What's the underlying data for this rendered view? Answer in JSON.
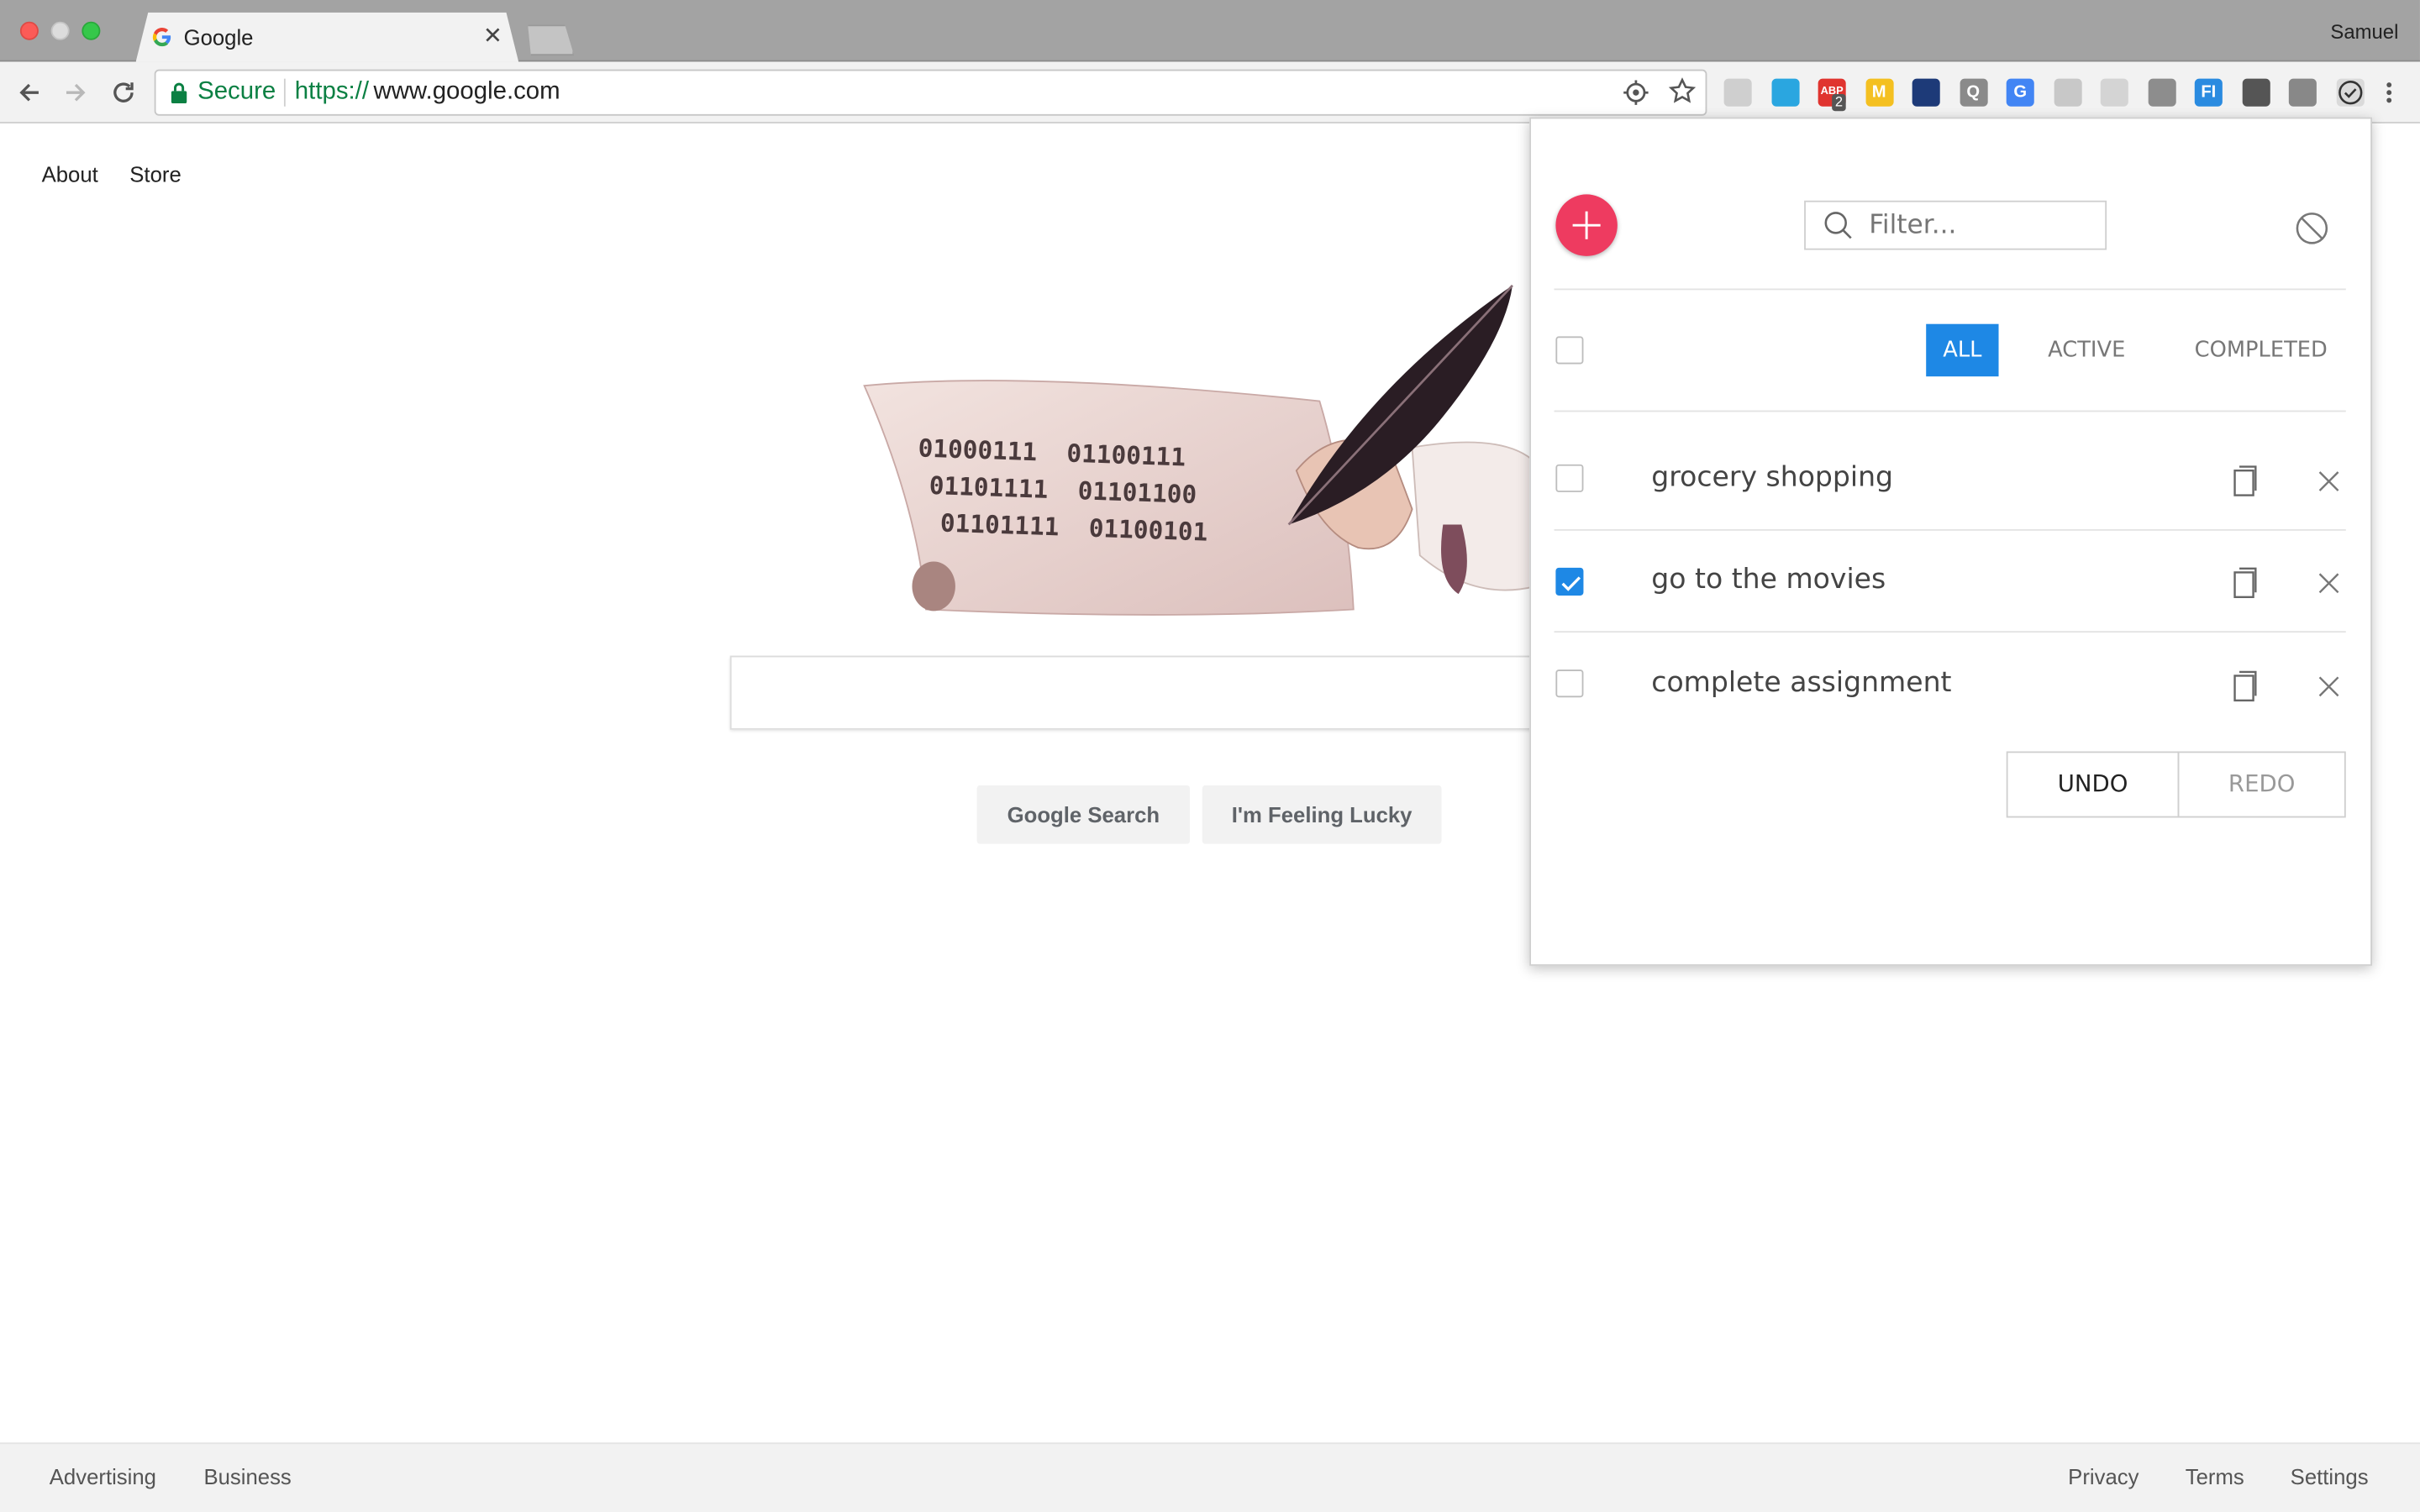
{
  "browser": {
    "tab_title": "Google",
    "profile_name": "Samuel",
    "secure_label": "Secure",
    "url_scheme": "https://",
    "url_host": "www.google.com",
    "extensions": [
      {
        "name": "grey-circle-extension-icon",
        "color": "#cfcfcf",
        "text": ""
      },
      {
        "name": "window-extension-icon",
        "color": "#2aa6e0",
        "text": ""
      },
      {
        "name": "adblock-extension-icon",
        "color": "#e0342f",
        "text": "ABP",
        "badge": "2"
      },
      {
        "name": "m-extension-icon",
        "color": "#f4c021",
        "text": "M"
      },
      {
        "name": "swirl-extension-icon",
        "color": "#1d3a78",
        "text": ""
      },
      {
        "name": "q-extension-icon",
        "color": "#8a8a8a",
        "text": "Q"
      },
      {
        "name": "google-extension-icon",
        "color": "#4285f4",
        "text": "G"
      },
      {
        "name": "grid-extension-icon",
        "color": "#c8c8c8",
        "text": ""
      },
      {
        "name": "target-extension-icon",
        "color": "#d4d4d4",
        "text": ""
      },
      {
        "name": "camera-extension-icon",
        "color": "#8d8d8d",
        "text": ""
      },
      {
        "name": "fi-extension-icon",
        "color": "#2a8be0",
        "text": "FI"
      },
      {
        "name": "screenshot-extension-icon",
        "color": "#555555",
        "text": ""
      },
      {
        "name": "settings-extension-icon",
        "color": "#888888",
        "text": ""
      },
      {
        "name": "todo-extension-icon",
        "color": "#444444",
        "text": ""
      }
    ]
  },
  "google": {
    "top_links": [
      "About",
      "Store"
    ],
    "doodle_binary": [
      "01000111",
      "01100111",
      "01101111",
      "01101100",
      "01101111",
      "01100101"
    ],
    "search_button": "Google Search",
    "lucky_button": "I'm Feeling Lucky",
    "footer_left": [
      "Advertising",
      "Business"
    ],
    "footer_right": [
      "Privacy",
      "Terms",
      "Settings"
    ]
  },
  "popup": {
    "filter_placeholder": "Filter...",
    "filters": [
      "ALL",
      "ACTIVE",
      "COMPLETED"
    ],
    "active_filter": "ALL",
    "accent_color": "#1e88e5",
    "add_button_color": "#ee3b60",
    "todos": [
      {
        "text": "grocery shopping",
        "completed": false
      },
      {
        "text": "go to the movies",
        "completed": true
      },
      {
        "text": "complete assignment",
        "completed": false
      }
    ],
    "undo_label": "UNDO",
    "redo_label": "REDO"
  }
}
